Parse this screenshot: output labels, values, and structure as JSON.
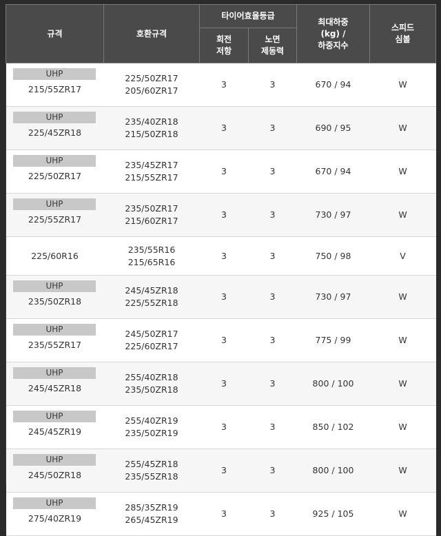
{
  "headers": {
    "size": "규격",
    "compatible": "호환규격",
    "efficiency_group": "타이어효율등급",
    "rolling_resistance": [
      "회전",
      "저항"
    ],
    "wet_grip": [
      "노면",
      "제동력"
    ],
    "max_load": [
      "최대하중",
      "(kg) /",
      "하중지수"
    ],
    "speed_symbol": [
      "스피드",
      "심볼"
    ]
  },
  "rows": [
    {
      "badge": "UHP",
      "size": "215/55ZR17",
      "compat": [
        "225/50ZR17",
        "205/60ZR17"
      ],
      "rolling": "3",
      "wet": "3",
      "load": "670 / 94",
      "speed": "W"
    },
    {
      "badge": "UHP",
      "size": "225/45ZR18",
      "compat": [
        "235/40ZR18",
        "215/50ZR18"
      ],
      "rolling": "3",
      "wet": "3",
      "load": "690 / 95",
      "speed": "W"
    },
    {
      "badge": "UHP",
      "size": "225/50ZR17",
      "compat": [
        "235/45ZR17",
        "215/55ZR17"
      ],
      "rolling": "3",
      "wet": "3",
      "load": "670 / 94",
      "speed": "W"
    },
    {
      "badge": "UHP",
      "size": "225/55ZR17",
      "compat": [
        "235/50ZR17",
        "215/60ZR17"
      ],
      "rolling": "3",
      "wet": "3",
      "load": "730 / 97",
      "speed": "W"
    },
    {
      "badge": "",
      "size": "225/60R16",
      "compat": [
        "235/55R16",
        "215/65R16"
      ],
      "rolling": "3",
      "wet": "3",
      "load": "750 / 98",
      "speed": "V"
    },
    {
      "badge": "UHP",
      "size": "235/50ZR18",
      "compat": [
        "245/45ZR18",
        "225/55ZR18"
      ],
      "rolling": "3",
      "wet": "3",
      "load": "730 / 97",
      "speed": "W"
    },
    {
      "badge": "UHP",
      "size": "235/55ZR17",
      "compat": [
        "245/50ZR17",
        "225/60ZR17"
      ],
      "rolling": "3",
      "wet": "3",
      "load": "775 / 99",
      "speed": "W"
    },
    {
      "badge": "UHP",
      "size": "245/45ZR18",
      "compat": [
        "255/40ZR18",
        "235/50ZR18"
      ],
      "rolling": "3",
      "wet": "3",
      "load": "800 / 100",
      "speed": "W"
    },
    {
      "badge": "UHP",
      "size": "245/45ZR19",
      "compat": [
        "255/40ZR19",
        "235/50ZR19"
      ],
      "rolling": "3",
      "wet": "3",
      "load": "850 / 102",
      "speed": "W"
    },
    {
      "badge": "UHP",
      "size": "245/50ZR18",
      "compat": [
        "255/45ZR18",
        "235/55ZR18"
      ],
      "rolling": "3",
      "wet": "3",
      "load": "800 / 100",
      "speed": "W"
    },
    {
      "badge": "UHP",
      "size": "275/40ZR19",
      "compat": [
        "285/35ZR19",
        "265/45ZR19"
      ],
      "rolling": "3",
      "wet": "3",
      "load": "925 / 105",
      "speed": "W"
    }
  ]
}
